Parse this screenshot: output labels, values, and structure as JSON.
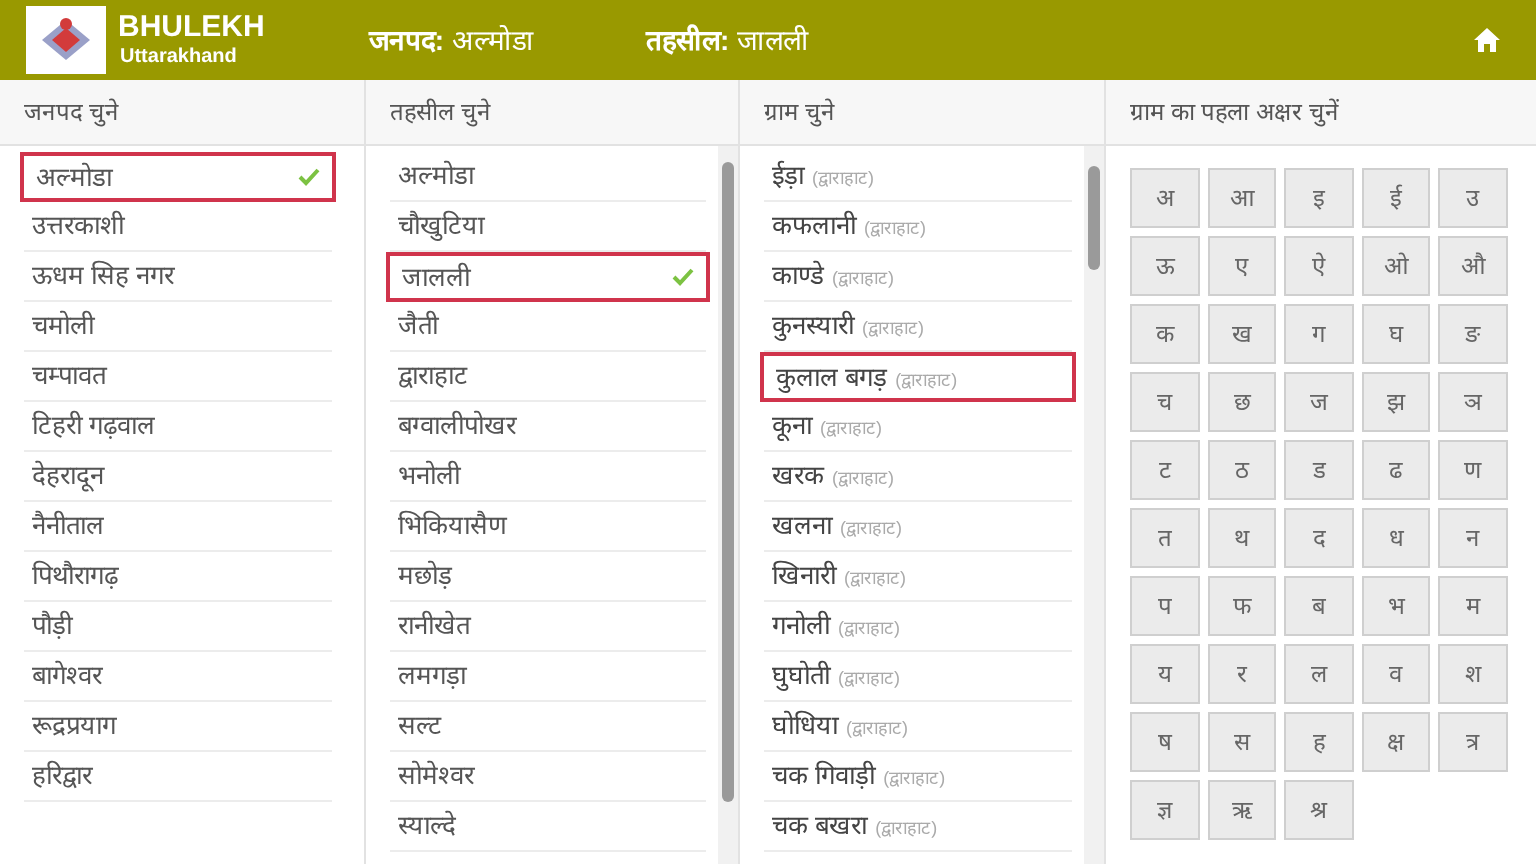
{
  "header": {
    "brand": "BHULEKH",
    "subtitle": "Uttarakhand",
    "district_label": "जनपद:",
    "district_value": "अल्मोडा",
    "tehsil_label": "तहसील:",
    "tehsil_value": "जालली"
  },
  "districts": {
    "heading": "जनपद चुने",
    "items": [
      {
        "name": "अल्मोडा",
        "selected": true
      },
      {
        "name": "उत्तरकाशी",
        "selected": false
      },
      {
        "name": "ऊधम सिह नगर",
        "selected": false
      },
      {
        "name": "चमोली",
        "selected": false
      },
      {
        "name": "चम्पावत",
        "selected": false
      },
      {
        "name": "टिहरी गढ़वाल",
        "selected": false
      },
      {
        "name": "देहरादून",
        "selected": false
      },
      {
        "name": "नैनीताल",
        "selected": false
      },
      {
        "name": "पिथौरागढ़",
        "selected": false
      },
      {
        "name": "पौड़ी",
        "selected": false
      },
      {
        "name": "बागेश्वर",
        "selected": false
      },
      {
        "name": "रूद्रप्रयाग",
        "selected": false
      },
      {
        "name": "हरिद्वार",
        "selected": false
      }
    ]
  },
  "tehsils": {
    "heading": "तहसील चुने",
    "items": [
      {
        "name": "अल्मोडा",
        "selected": false
      },
      {
        "name": "चौखुटिया",
        "selected": false
      },
      {
        "name": "जालली",
        "selected": true
      },
      {
        "name": "जैती",
        "selected": false
      },
      {
        "name": "द्वाराहाट",
        "selected": false
      },
      {
        "name": "बग्वालीपोखर",
        "selected": false
      },
      {
        "name": "भनोली",
        "selected": false
      },
      {
        "name": "भिकियासैण",
        "selected": false
      },
      {
        "name": "मछोड़",
        "selected": false
      },
      {
        "name": "रानीखेत",
        "selected": false
      },
      {
        "name": "लमगड़ा",
        "selected": false
      },
      {
        "name": "सल्ट",
        "selected": false
      },
      {
        "name": "सोमेश्वर",
        "selected": false
      },
      {
        "name": "स्याल्दे",
        "selected": false
      }
    ]
  },
  "villages": {
    "heading": "ग्राम चुने",
    "items": [
      {
        "name": "ईड़ा",
        "tehsil": "(द्वाराहाट)",
        "selected": false
      },
      {
        "name": "कफलानी",
        "tehsil": "(द्वाराहाट)",
        "selected": false
      },
      {
        "name": "काण्डे",
        "tehsil": "(द्वाराहाट)",
        "selected": false
      },
      {
        "name": "कुनस्यारी",
        "tehsil": "(द्वाराहाट)",
        "selected": false
      },
      {
        "name": "कुलाल बगड़",
        "tehsil": "(द्वाराहाट)",
        "selected": true
      },
      {
        "name": "कूना",
        "tehsil": "(द्वाराहाट)",
        "selected": false
      },
      {
        "name": "खरक",
        "tehsil": "(द्वाराहाट)",
        "selected": false
      },
      {
        "name": "खलना",
        "tehsil": "(द्वाराहाट)",
        "selected": false
      },
      {
        "name": "खिनारी",
        "tehsil": "(द्वाराहाट)",
        "selected": false
      },
      {
        "name": "गनोली",
        "tehsil": "(द्वाराहाट)",
        "selected": false
      },
      {
        "name": "घुघोती",
        "tehsil": "(द्वाराहाट)",
        "selected": false
      },
      {
        "name": "घोधिया",
        "tehsil": "(द्वाराहाट)",
        "selected": false
      },
      {
        "name": "चक गिवाड़ी",
        "tehsil": "(द्वाराहाट)",
        "selected": false
      },
      {
        "name": "चक बखरा",
        "tehsil": "(द्वाराहाट)",
        "selected": false
      }
    ]
  },
  "letters": {
    "heading": "ग्राम का पहला अक्षर चुनें",
    "items": [
      "अ",
      "आ",
      "इ",
      "ई",
      "उ",
      "ऊ",
      "ए",
      "ऐ",
      "ओ",
      "औ",
      "क",
      "ख",
      "ग",
      "घ",
      "ङ",
      "च",
      "छ",
      "ज",
      "झ",
      "ञ",
      "ट",
      "ठ",
      "ड",
      "ढ",
      "ण",
      "त",
      "थ",
      "द",
      "ध",
      "न",
      "प",
      "फ",
      "ब",
      "भ",
      "म",
      "य",
      "र",
      "ल",
      "व",
      "श",
      "ष",
      "स",
      "ह",
      "क्ष",
      "त्र",
      "ज्ञ",
      "ऋ",
      "श्र"
    ]
  }
}
